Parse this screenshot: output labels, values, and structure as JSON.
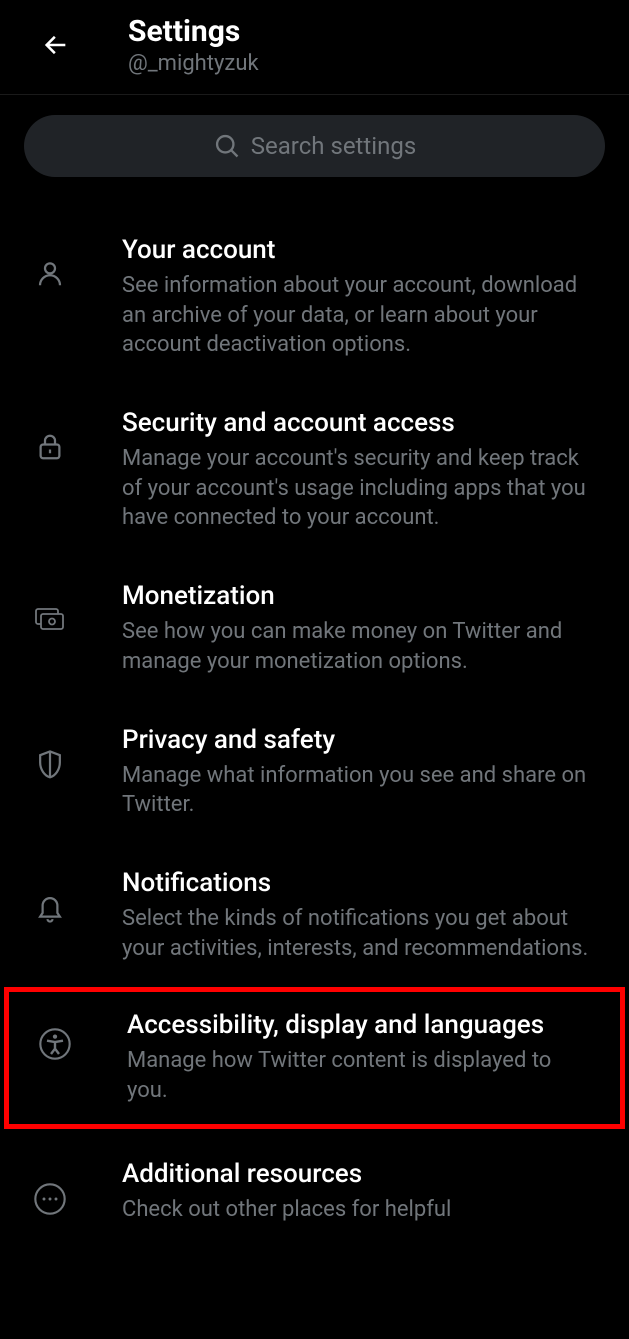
{
  "header": {
    "title": "Settings",
    "handle": "@_mightyzuk"
  },
  "search": {
    "placeholder": "Search settings"
  },
  "items": [
    {
      "icon": "user",
      "title": "Your account",
      "desc": "See information about your account, download an archive of your data, or learn about your account deactivation options."
    },
    {
      "icon": "lock",
      "title": "Security and account access",
      "desc": "Manage your account's security and keep track of your account's usage including apps that you have connected to your account."
    },
    {
      "icon": "money",
      "title": "Monetization",
      "desc": "See how you can make money on Twitter and manage your monetization options."
    },
    {
      "icon": "shield",
      "title": "Privacy and safety",
      "desc": "Manage what information you see and share on Twitter."
    },
    {
      "icon": "bell",
      "title": "Notifications",
      "desc": "Select the kinds of notifications you get about your activities, interests, and recommendations."
    },
    {
      "icon": "accessibility",
      "title": "Accessibility, display and languages",
      "desc": "Manage how Twitter content is displayed to you."
    },
    {
      "icon": "more",
      "title": "Additional resources",
      "desc": "Check out other places for helpful"
    }
  ]
}
